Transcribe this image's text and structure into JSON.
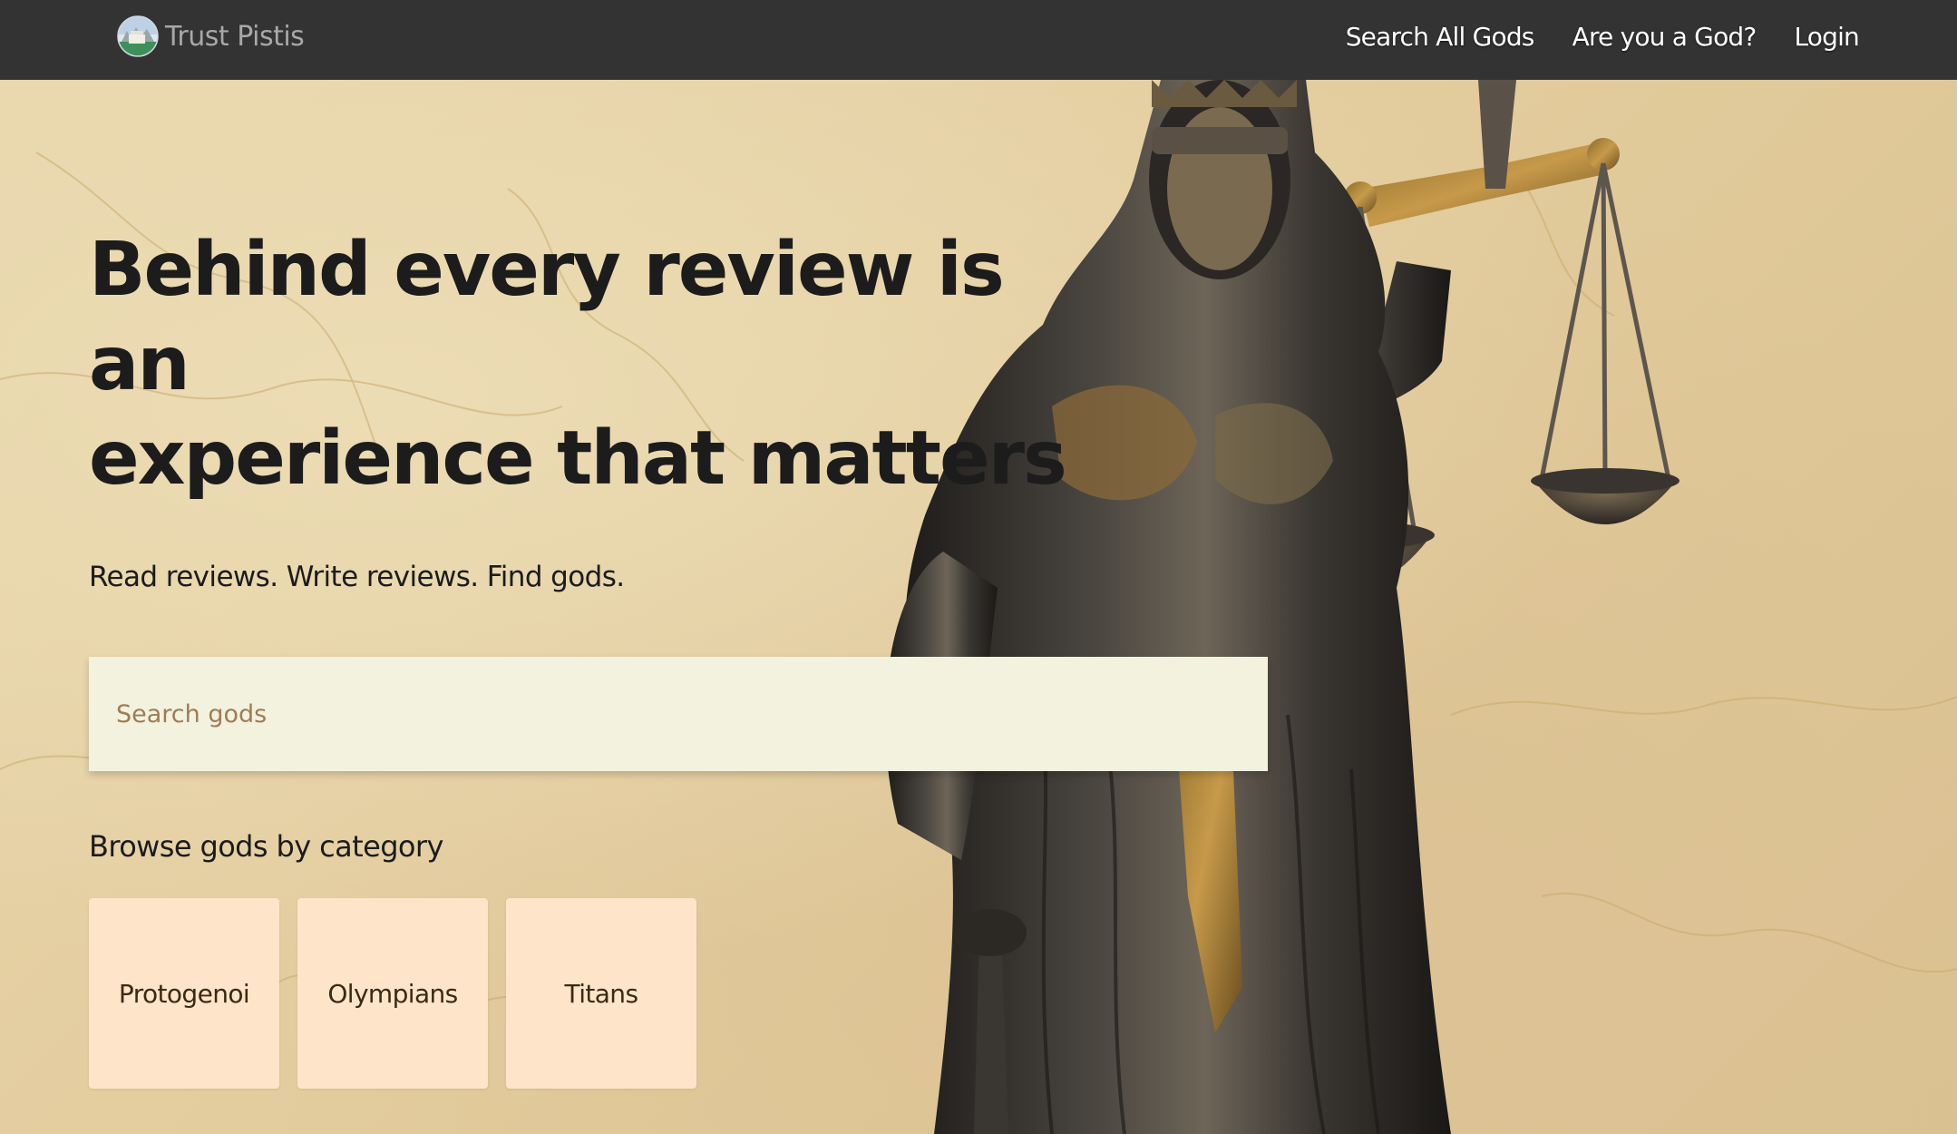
{
  "navbar": {
    "brand_name": "Trust Pistis",
    "links": [
      {
        "label": "Search All Gods"
      },
      {
        "label": "Are you a God?"
      },
      {
        "label": "Login"
      }
    ]
  },
  "hero": {
    "headline_line1": "Behind every review is an",
    "headline_line2": "experience that matters",
    "tagline": "Read reviews. Write reviews. Find gods.",
    "search": {
      "placeholder": "Search gods",
      "value": ""
    },
    "browse_heading": "Browse gods by category",
    "categories": [
      {
        "label": "Protogenoi"
      },
      {
        "label": "Olympians"
      },
      {
        "label": "Titans"
      }
    ],
    "background_image": "lady-justice-statue",
    "background_texture": "cracked-parchment"
  },
  "colors": {
    "navbar": "#333333",
    "brand_text": "#a8a8a8",
    "nav_link": "#ffffff",
    "hero_bg": "#e6d2a6",
    "heading_text": "#1c1c1c",
    "search_bg": "#f3f2df",
    "search_placeholder": "#9d7d56",
    "category_card": "#fee4c9",
    "category_text": "#3a2a14"
  }
}
